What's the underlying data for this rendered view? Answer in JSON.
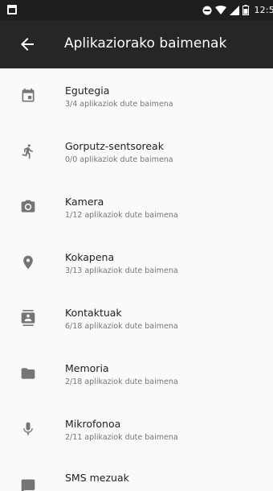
{
  "status_bar": {
    "time": "12:5",
    "icons": [
      "notification-icon",
      "do-not-disturb-icon",
      "wifi-icon",
      "signal-icon",
      "battery-icon"
    ]
  },
  "app_bar": {
    "back_icon": "arrow-back-icon",
    "title": "Aplikaziorako baimenak"
  },
  "permissions": [
    {
      "icon": "calendar-icon",
      "label": "Egutegia",
      "summary": "3/4 aplikaziok dute baimena"
    },
    {
      "icon": "body-sensors-icon",
      "label": "Gorputz-sentsoreak",
      "summary": "0/0 aplikaziok dute baimena"
    },
    {
      "icon": "camera-icon",
      "label": "Kamera",
      "summary": "1/12 aplikaziok dute baimena"
    },
    {
      "icon": "location-icon",
      "label": "Kokapena",
      "summary": "3/13 aplikaziok dute baimena"
    },
    {
      "icon": "contacts-icon",
      "label": "Kontaktuak",
      "summary": "6/18 aplikaziok dute baimena"
    },
    {
      "icon": "storage-folder-icon",
      "label": "Memoria",
      "summary": "2/18 aplikaziok dute baimena"
    },
    {
      "icon": "microphone-icon",
      "label": "Mikrofonoa",
      "summary": "2/11 aplikaziok dute baimena"
    },
    {
      "icon": "sms-icon",
      "label": "SMS mezuak",
      "summary": ""
    }
  ],
  "colors": {
    "status_bar_bg": "#1e1e1e",
    "app_bar_bg": "#262626",
    "list_bg": "#fafafa",
    "icon_color": "#757575",
    "label_color": "#212121",
    "summary_color": "#757575"
  }
}
